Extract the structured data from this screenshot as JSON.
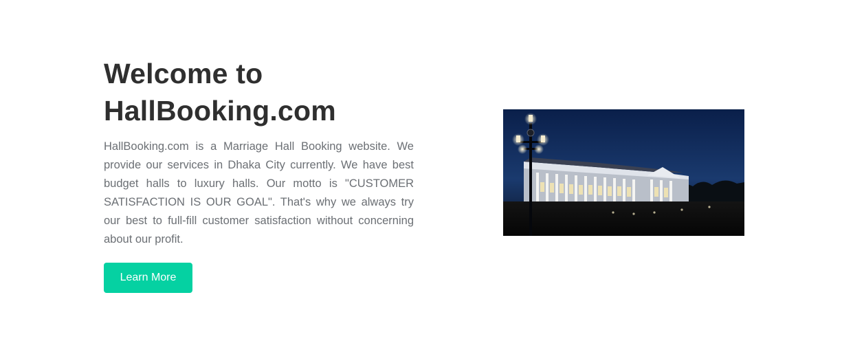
{
  "about": {
    "heading_line1": "Welcome to",
    "heading_line2": "HallBooking.com",
    "description": "HallBooking.com is a Marriage Hall Booking website. We provide our services in Dhaka City currently. We have best budget halls to luxury halls. Our motto is \"CUSTOMER SATISFACTION IS OUR GOAL\". That's why we always try our best to full-fill customer satisfaction without concerning about our profit.",
    "button_label": "Learn More",
    "image_icon": "hall-photo",
    "accent_color": "#05d1a2"
  }
}
